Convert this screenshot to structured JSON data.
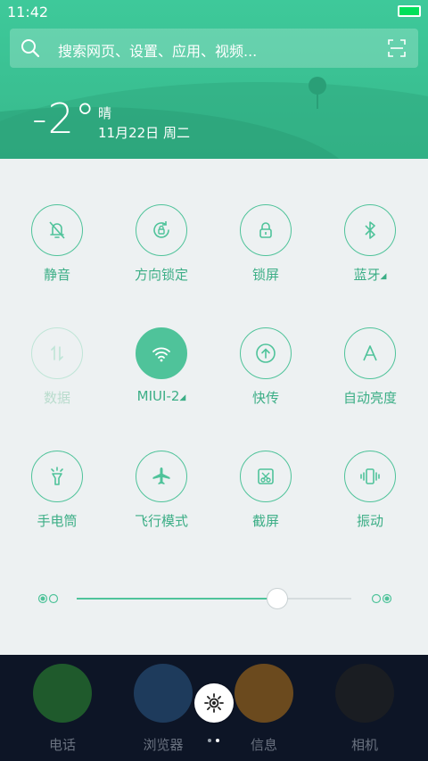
{
  "status": {
    "time": "11:42"
  },
  "search": {
    "placeholder": "搜索网页、设置、应用、视频..."
  },
  "weather": {
    "temperature": "-2°",
    "condition": "晴",
    "date": "11月22日 周二"
  },
  "toggles": [
    {
      "label": "静音",
      "icon": "bell-off-icon",
      "state": "off"
    },
    {
      "label": "方向锁定",
      "icon": "rotation-lock-icon",
      "state": "off"
    },
    {
      "label": "锁屏",
      "icon": "lock-icon",
      "state": "off"
    },
    {
      "label": "蓝牙",
      "icon": "bluetooth-icon",
      "state": "off",
      "has_menu": true
    },
    {
      "label": "数据",
      "icon": "mobile-data-icon",
      "state": "disabled"
    },
    {
      "label": "MIUI-2",
      "icon": "wifi-icon",
      "state": "on",
      "has_menu": true
    },
    {
      "label": "快传",
      "icon": "upload-icon",
      "state": "off"
    },
    {
      "label": "自动亮度",
      "icon": "auto-brightness-icon",
      "state": "off"
    },
    {
      "label": "手电筒",
      "icon": "flashlight-icon",
      "state": "off"
    },
    {
      "label": "飞行模式",
      "icon": "airplane-icon",
      "state": "off"
    },
    {
      "label": "截屏",
      "icon": "screenshot-icon",
      "state": "off"
    },
    {
      "label": "振动",
      "icon": "vibrate-icon",
      "state": "off"
    }
  ],
  "brightness": {
    "level": 0.73
  },
  "dock": [
    {
      "label": "电话",
      "icon": "phone-icon",
      "color": "#1f5a2c"
    },
    {
      "label": "浏览器",
      "icon": "browser-icon",
      "color": "#1e3b5c"
    },
    {
      "label": "信息",
      "icon": "message-icon",
      "color": "#6b4a1e"
    },
    {
      "label": "相机",
      "icon": "camera-icon",
      "color": "#1a1d22"
    }
  ],
  "colors": {
    "accent": "#4fc39a",
    "header": "#3ec99a",
    "panel": "#edf1f2"
  }
}
